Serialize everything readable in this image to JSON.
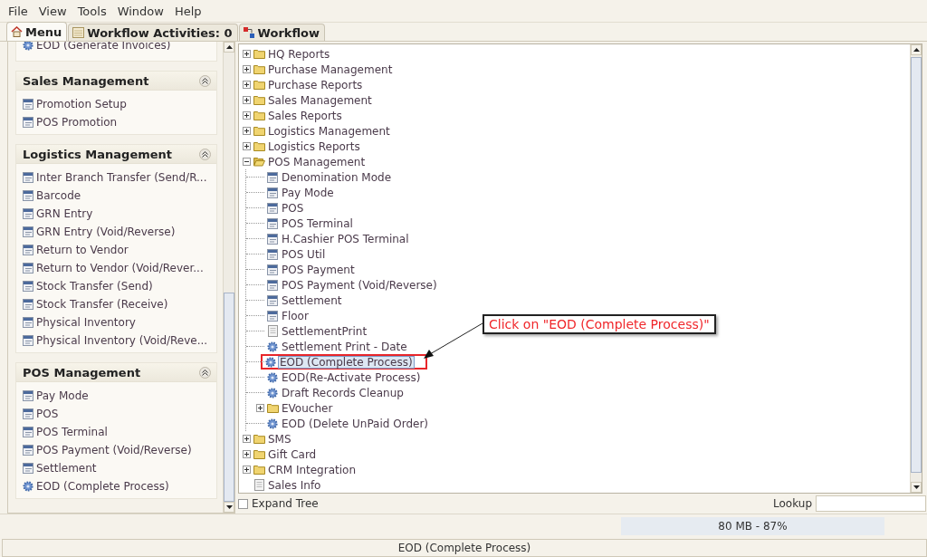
{
  "menu": [
    {
      "label": "File"
    },
    {
      "label": "View"
    },
    {
      "label": "Tools"
    },
    {
      "label": "Window"
    },
    {
      "label": "Help"
    }
  ],
  "tabs": [
    {
      "label": "Menu",
      "kind": "home",
      "selected": true
    },
    {
      "label": "Workflow Activities: 0",
      "kind": "activities",
      "selected": false
    },
    {
      "label": "Workflow",
      "kind": "workflow",
      "selected": false
    }
  ],
  "sidebar": {
    "sections": [
      {
        "items": [
          {
            "label": "EOD (Generate Invoices)",
            "kind": "process"
          }
        ]
      },
      {
        "title": "Sales Management",
        "expanded": true,
        "items": [
          {
            "label": "Promotion Setup",
            "kind": "window"
          },
          {
            "label": "POS Promotion",
            "kind": "window"
          }
        ]
      },
      {
        "title": "Logistics Management",
        "expanded": true,
        "items": [
          {
            "label": "Inter Branch Transfer (Send/R...",
            "kind": "window"
          },
          {
            "label": "Barcode",
            "kind": "window"
          },
          {
            "label": "GRN Entry",
            "kind": "window"
          },
          {
            "label": "GRN Entry (Void/Reverse)",
            "kind": "window"
          },
          {
            "label": "Return to Vendor",
            "kind": "window"
          },
          {
            "label": "Return to Vendor (Void/Rever...",
            "kind": "window"
          },
          {
            "label": "Stock Transfer (Send)",
            "kind": "window"
          },
          {
            "label": "Stock Transfer (Receive)",
            "kind": "window"
          },
          {
            "label": "Physical Inventory",
            "kind": "window"
          },
          {
            "label": "Physical Inventory (Void/Reve...",
            "kind": "window"
          }
        ]
      },
      {
        "title": "POS Management",
        "expanded": true,
        "items": [
          {
            "label": "Pay Mode",
            "kind": "window"
          },
          {
            "label": "POS",
            "kind": "window"
          },
          {
            "label": "POS Terminal",
            "kind": "window"
          },
          {
            "label": "POS Payment (Void/Reverse)",
            "kind": "window"
          },
          {
            "label": "Settlement",
            "kind": "window"
          },
          {
            "label": "EOD (Complete Process)",
            "kind": "process"
          }
        ]
      }
    ]
  },
  "tree": {
    "items": [
      {
        "label": "HQ Reports",
        "kind": "folder",
        "expanded": false,
        "selected": false
      },
      {
        "label": "Purchase Management",
        "kind": "folder",
        "expanded": false,
        "selected": false
      },
      {
        "label": "Purchase Reports",
        "kind": "folder",
        "expanded": false,
        "selected": false
      },
      {
        "label": "Sales Management",
        "kind": "folder",
        "expanded": false,
        "selected": false
      },
      {
        "label": "Sales Reports",
        "kind": "folder",
        "expanded": false,
        "selected": false
      },
      {
        "label": "Logistics Management",
        "kind": "folder",
        "expanded": false,
        "selected": false
      },
      {
        "label": "Logistics Reports",
        "kind": "folder",
        "expanded": false,
        "selected": false
      },
      {
        "label": "POS Management",
        "kind": "folder",
        "expanded": true,
        "selected": false,
        "children": [
          {
            "label": "Denomination Mode",
            "kind": "window",
            "selected": false
          },
          {
            "label": "Pay Mode",
            "kind": "window",
            "selected": false
          },
          {
            "label": "POS",
            "kind": "window",
            "selected": false
          },
          {
            "label": "POS Terminal",
            "kind": "window",
            "selected": false
          },
          {
            "label": "H.Cashier POS Terminal",
            "kind": "window",
            "selected": false
          },
          {
            "label": "POS Util",
            "kind": "window",
            "selected": false
          },
          {
            "label": "POS Payment",
            "kind": "window",
            "selected": false
          },
          {
            "label": "POS Payment (Void/Reverse)",
            "kind": "window",
            "selected": false
          },
          {
            "label": "Settlement",
            "kind": "window",
            "selected": false
          },
          {
            "label": "Floor",
            "kind": "window",
            "selected": false
          },
          {
            "label": "SettlementPrint",
            "kind": "report",
            "selected": false
          },
          {
            "label": "Settlement Print - Date",
            "kind": "process",
            "selected": false
          },
          {
            "label": "EOD (Complete Process)",
            "kind": "process",
            "selected": true
          },
          {
            "label": "EOD(Re-Activate Process)",
            "kind": "process",
            "selected": false
          },
          {
            "label": "Draft Records Cleanup",
            "kind": "process",
            "selected": false
          },
          {
            "label": "EVoucher",
            "kind": "folder",
            "expanded": false,
            "selected": false
          },
          {
            "label": "EOD (Delete UnPaid Order)",
            "kind": "process",
            "selected": false
          }
        ]
      },
      {
        "label": "SMS",
        "kind": "folder",
        "expanded": false,
        "selected": false
      },
      {
        "label": "Gift Card",
        "kind": "folder",
        "expanded": false,
        "selected": false
      },
      {
        "label": "CRM Integration",
        "kind": "folder",
        "expanded": false,
        "selected": false
      },
      {
        "label": "Sales Info",
        "kind": "report",
        "selected": false
      }
    ]
  },
  "callout": {
    "text": "Click on \"EOD (Complete Process)\""
  },
  "expand_tree": {
    "label": "Expand Tree",
    "checked": false
  },
  "lookup": {
    "label": "Lookup"
  },
  "memory": {
    "text": "80 MB - 87%"
  },
  "status_bar": {
    "text": "EOD (Complete Process)"
  }
}
